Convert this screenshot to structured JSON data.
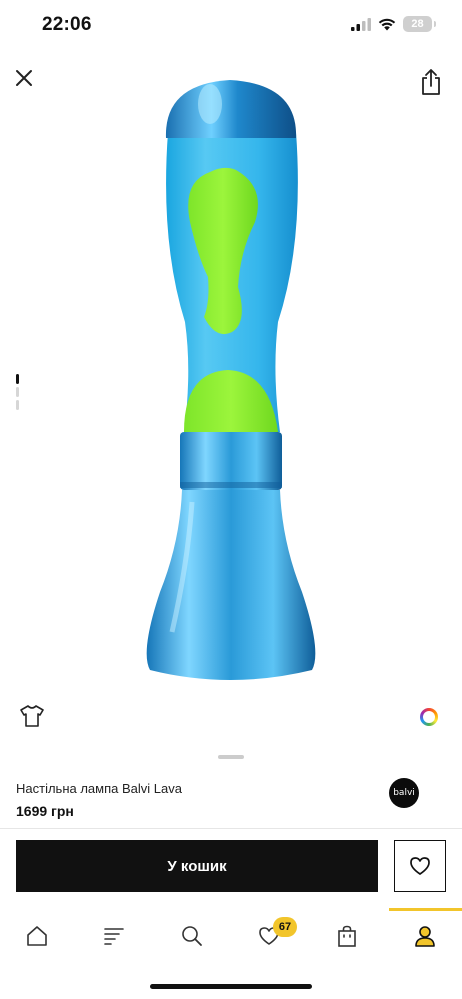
{
  "status_bar": {
    "time": "22:06",
    "battery": "28",
    "icons": [
      "signal-icon",
      "wifi-icon",
      "battery-icon"
    ]
  },
  "top_bar": {
    "icons": [
      "close-icon",
      "share-icon"
    ]
  },
  "gallery": {
    "slide_count": 3,
    "active_slide": 1
  },
  "product": {
    "title": "Настільна лампа Balvi Lava",
    "price": "1699 грн",
    "brand": "balvi"
  },
  "actions": {
    "cart_label": "У кошик",
    "wishlist_icon": "heart-icon"
  },
  "tab_bar": {
    "items": [
      "home-icon",
      "catalog-icon",
      "search-icon",
      "wishlist-icon",
      "bag-icon",
      "profile-icon"
    ],
    "wishlist_badge": "67",
    "active": "profile"
  },
  "colors": {
    "accent": "#f2c52b",
    "button": "#111111",
    "lamp_blue": "#2fb0e8",
    "lava_green": "#8cf02a"
  }
}
